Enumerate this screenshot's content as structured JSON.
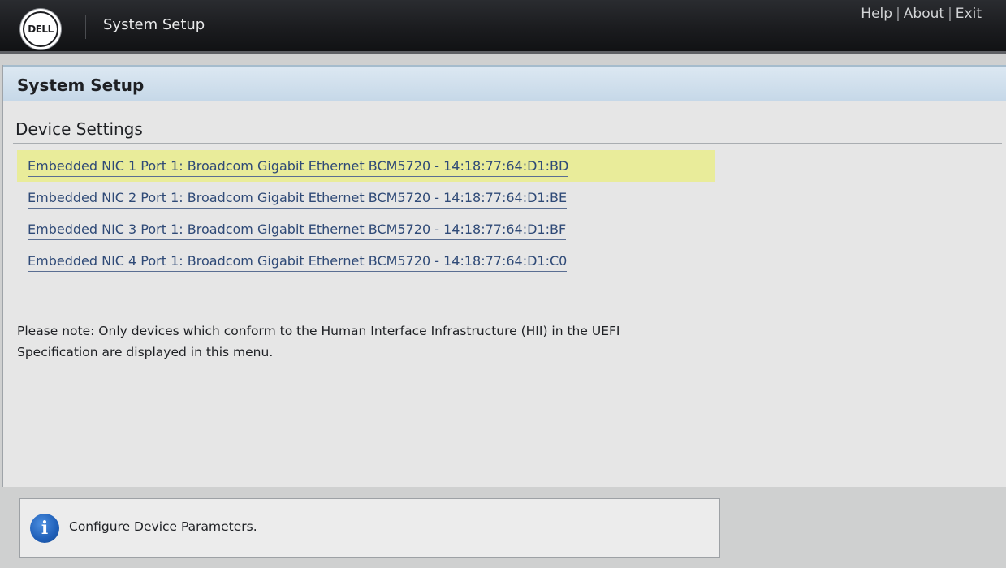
{
  "header": {
    "logo_text": "DELL",
    "app_title": "System Setup",
    "links": [
      "Help",
      "About",
      "Exit"
    ],
    "separator": "|"
  },
  "panel": {
    "title": "System Setup",
    "section_title": "Device Settings",
    "devices": [
      {
        "label": "Embedded NIC 1 Port 1: Broadcom Gigabit Ethernet BCM5720 - 14:18:77:64:D1:BD",
        "selected": true
      },
      {
        "label": "Embedded NIC 2 Port 1: Broadcom Gigabit Ethernet BCM5720 - 14:18:77:64:D1:BE",
        "selected": false
      },
      {
        "label": "Embedded NIC 3 Port 1: Broadcom Gigabit Ethernet BCM5720 - 14:18:77:64:D1:BF",
        "selected": false
      },
      {
        "label": "Embedded NIC 4 Port 1: Broadcom Gigabit Ethernet BCM5720 - 14:18:77:64:D1:C0",
        "selected": false
      }
    ],
    "note_line1": "Please note: Only devices which conform to the Human Interface Infrastructure (HII) in the UEFI",
    "note_line2": "Specification are displayed in this menu."
  },
  "info": {
    "icon": "info-icon",
    "icon_glyph": "i",
    "text": "Configure Device Parameters."
  },
  "colors": {
    "selection_highlight": "#e9ec9a",
    "link": "#2f4a77",
    "header_bar": "#1b1c1f",
    "panel_header": "#c6d8e8"
  }
}
